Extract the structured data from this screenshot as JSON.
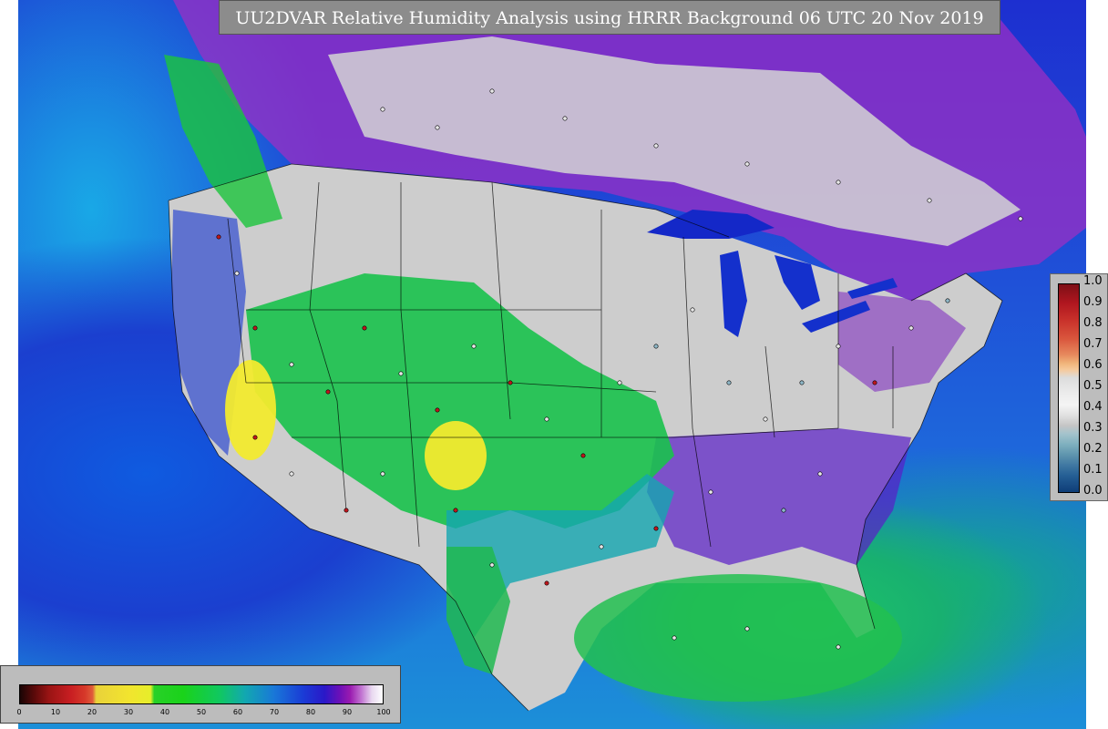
{
  "title": "UU2DVAR Relative Humidity Analysis using HRRR Background 06 UTC 20 Nov 2019",
  "side_colorbar": {
    "ticks": [
      "1.0",
      "0.9",
      "0.8",
      "0.7",
      "0.6",
      "0.5",
      "0.4",
      "0.3",
      "0.2",
      "0.1",
      "0.0"
    ]
  },
  "bottom_colorbar": {
    "ticks": [
      "0",
      "10",
      "20",
      "30",
      "40",
      "50",
      "60",
      "70",
      "80",
      "90",
      "100"
    ]
  },
  "colors": {
    "ocean": "#1f52d8",
    "land_dry": "#cfcfcf",
    "humid_green": "#18c64a",
    "very_dry_yellow": "#f2ea2e",
    "saturated_purple": "#6a18c0",
    "banner": "#8c8c8c"
  }
}
